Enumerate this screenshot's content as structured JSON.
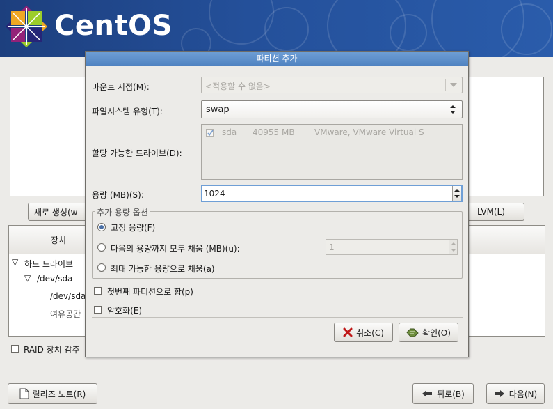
{
  "brand": {
    "name": "CentOS"
  },
  "background": {
    "buttons": {
      "new": "새로 생성(w",
      "lvm": "LVM(L)"
    },
    "table": {
      "col_device": "장치"
    },
    "tree": [
      {
        "label": "하드 드라이브",
        "level": 0,
        "expander": "▽"
      },
      {
        "label": "/dev/sda",
        "level": 1,
        "expander": "▽"
      },
      {
        "label": "/dev/sda",
        "level": 2,
        "expander": ""
      },
      {
        "label": "여유공간",
        "level": 2,
        "expander": ""
      }
    ],
    "raid_checkbox_label": "RAID 장치 감추",
    "footer": {
      "release_notes": "릴리즈 노트(R)",
      "back": "뒤로(B)",
      "next": "다음(N)"
    }
  },
  "dialog": {
    "title": "파티션 추가",
    "mount_point": {
      "label": "마운트 지점(M):",
      "value": "<적용할 수 없음>"
    },
    "filesystem": {
      "label": "파일시스템 유형(T):",
      "value": "swap"
    },
    "drives": {
      "label": "할당 가능한 드라이브(D):",
      "rows": [
        {
          "checked": true,
          "name": "sda",
          "size": "40955 MB",
          "model": "VMware, VMware Virtual S"
        }
      ]
    },
    "size": {
      "label": "용량 (MB)(S):",
      "value": "1024"
    },
    "options": {
      "legend": "추가 용량 옵션",
      "fixed": "고정 용량(F)",
      "fill_upto": "다음의 용량까지 모두 채움 (MB)(u):",
      "fill_upto_value": "1",
      "fill_max": "최대 가능한 용량으로 채움(a)",
      "selected": "fixed"
    },
    "primary": {
      "label": "첫번째 파티션으로 함(p)",
      "checked": false
    },
    "encrypt": {
      "label": "암호화(E)",
      "checked": false
    },
    "buttons": {
      "cancel": "취소(C)",
      "ok": "확인(O)"
    }
  },
  "colors": {
    "header_blue": "#24509a",
    "title_blue": "#5b8cc9",
    "focus": "#6f9fd6"
  }
}
